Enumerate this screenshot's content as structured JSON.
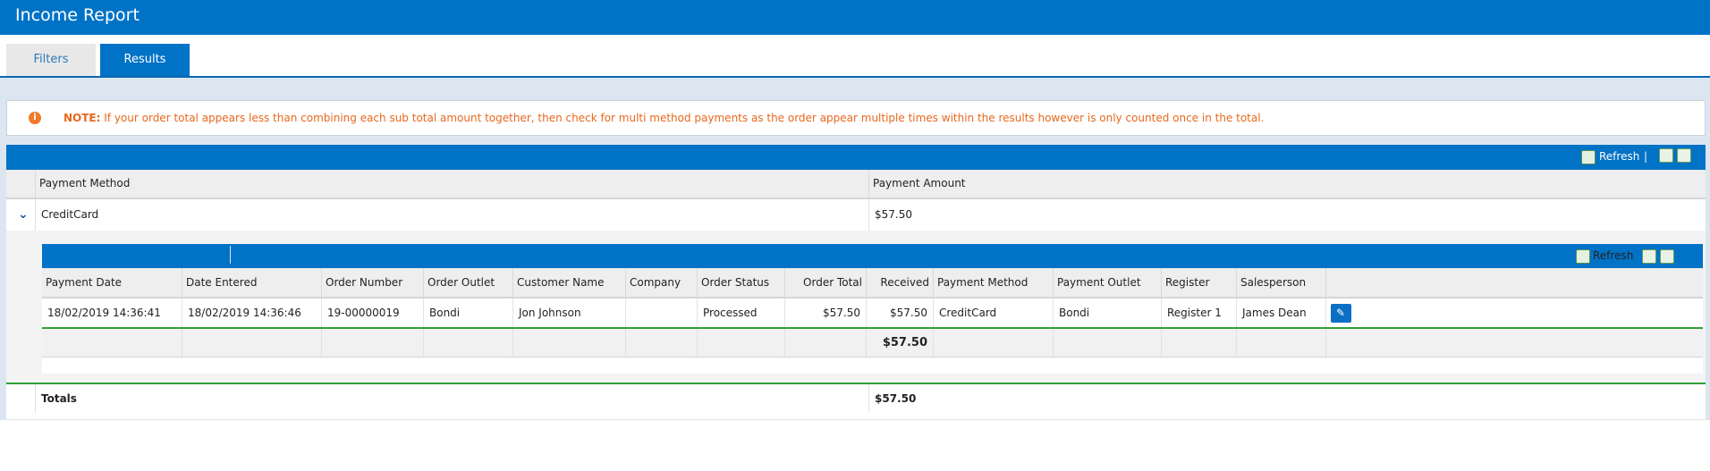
{
  "app": {
    "title": "Income Report"
  },
  "tabs": {
    "filters": "Filters",
    "results": "Results"
  },
  "note": {
    "label": "NOTE:",
    "text": " If your order total appears less than combining each sub total amount together, then check for multi method payments as the order appear multiple times within the results however is only counted once in the total."
  },
  "toolbar": {
    "refresh_label": "Refresh",
    "separator": "|"
  },
  "grid": {
    "columns": [
      "Payment Method",
      "Payment Amount"
    ],
    "row": {
      "method": "CreditCard",
      "amount": "$57.50"
    },
    "totals": {
      "label": "Totals",
      "amount": "$57.50"
    }
  },
  "detail": {
    "columns": [
      "Payment Date",
      "Date Entered",
      "Order Number",
      "Order Outlet",
      "Customer Name",
      "Company",
      "Order Status",
      "Order Total",
      "Received",
      "Payment Method",
      "Payment Outlet",
      "Register",
      "Salesperson"
    ],
    "row": {
      "payment_date": "18/02/2019 14:36:41",
      "date_entered": "18/02/2019 14:36:46",
      "order_number": "19-00000019",
      "order_outlet": "Bondi",
      "customer_name": "Jon Johnson",
      "company": "",
      "order_status": "Processed",
      "order_total": "$57.50",
      "received": "$57.50",
      "payment_method": "CreditCard",
      "payment_outlet": "Bondi",
      "register": "Register 1",
      "salesperson": "James Dean"
    },
    "footer": {
      "received_total": "$57.50"
    }
  },
  "icons": {
    "info": "info-icon",
    "refresh": "refresh-icon",
    "excel": "excel-export-icon",
    "csv": "csv-export-icon",
    "expand": "chevron-down-icon",
    "edit": "pencil-icon"
  },
  "colors": {
    "brand": "#0073c6",
    "note": "#e8671d",
    "accent_green": "#2fa03a"
  }
}
